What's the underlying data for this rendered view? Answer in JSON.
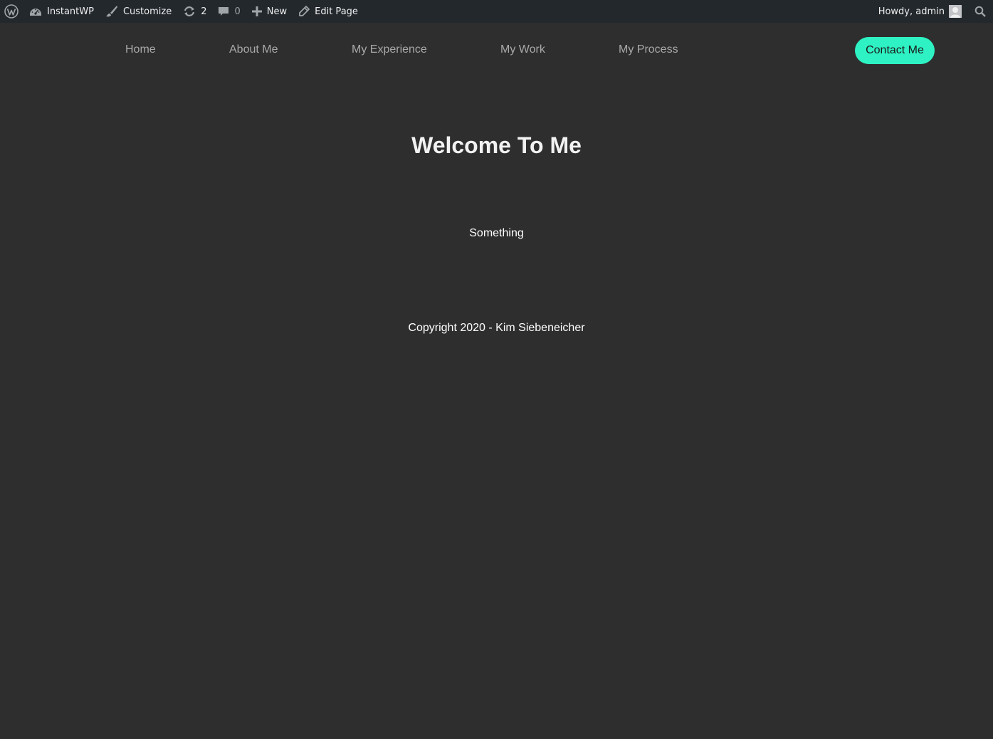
{
  "admin_bar": {
    "site_name": "InstantWP",
    "customize": "Customize",
    "updates_count": "2",
    "comments_count": "0",
    "new_label": "New",
    "edit_page": "Edit Page",
    "greeting": "Howdy, admin"
  },
  "nav": {
    "items": [
      {
        "label": "Home"
      },
      {
        "label": "About Me"
      },
      {
        "label": "My Experience"
      },
      {
        "label": "My Work"
      },
      {
        "label": "My Process"
      }
    ],
    "cta": "Contact Me"
  },
  "main": {
    "title": "Welcome To Me",
    "text": "Something"
  },
  "footer": {
    "copyright": "Copyright 2020 - Kim Siebeneicher"
  },
  "colors": {
    "background": "#2e2e2e",
    "admin_bar": "#23282d",
    "accent": "#2ef2c3",
    "nav_text": "#a9a9a9"
  },
  "icons": [
    "wordpress-logo-icon",
    "dashboard-icon",
    "customize-brush-icon",
    "updates-icon",
    "comments-icon",
    "plus-icon",
    "edit-pencil-icon",
    "avatar",
    "search-icon"
  ]
}
